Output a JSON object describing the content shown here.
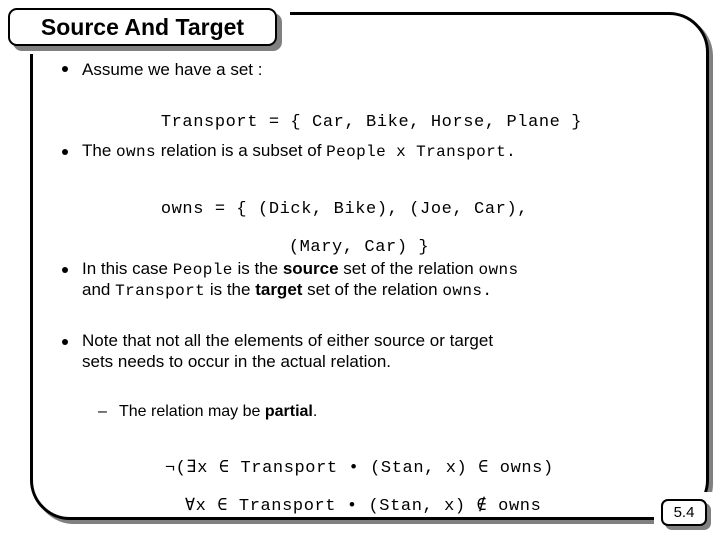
{
  "slide": {
    "title": "Source And Target",
    "page_number": "5.4",
    "accent_color": "#000000",
    "shadow_color": "#808080",
    "background_color": "#ffffff"
  },
  "bullets": [
    {
      "marker": "bullet-dot",
      "text_before": "Assume we have a set :",
      "code_lines": [
        "Transport = { Car, Bike, Horse, Plane }"
      ]
    },
    {
      "marker": "bullet-dot",
      "parts": [
        {
          "text": "The ",
          "style": "normal"
        },
        {
          "text": "owns",
          "style": "mono"
        },
        {
          "text": " relation is a subset of ",
          "style": "normal"
        },
        {
          "text": "People x Transport.",
          "style": "mono"
        }
      ],
      "code_lines": [
        "owns = { (Dick, Bike), (Joe, Car),",
        "(Mary, Car) }"
      ]
    },
    {
      "marker": "bullet-dot",
      "line1": [
        {
          "text": "In this case ",
          "style": "normal"
        },
        {
          "text": "People",
          "style": "mono"
        },
        {
          "text": " is the ",
          "style": "normal"
        },
        {
          "text": "source",
          "style": "bold"
        },
        {
          "text": " set of the relation ",
          "style": "normal"
        },
        {
          "text": "owns",
          "style": "mono"
        }
      ],
      "line2": [
        {
          "text": "and ",
          "style": "normal"
        },
        {
          "text": "Transport",
          "style": "mono"
        },
        {
          "text": " is the ",
          "style": "normal"
        },
        {
          "text": "target",
          "style": "bold"
        },
        {
          "text": " set of the relation ",
          "style": "normal"
        },
        {
          "text": "owns.",
          "style": "mono"
        }
      ]
    },
    {
      "marker": "bullet-dot",
      "line1": "Note that not all the elements of either source or target",
      "line2": "sets needs to occur in the actual relation."
    }
  ],
  "sub_bullet": {
    "marker": "–",
    "parts": [
      {
        "text": "The relation may be ",
        "style": "normal"
      },
      {
        "text": "partial",
        "style": "bold"
      },
      {
        "text": ".",
        "style": "normal"
      }
    ]
  },
  "formulas": [
    "¬(∃x ∈ Transport • (Stan, x) ∈ owns)",
    "∀x ∈ Transport • (Stan, x) ∉ owns"
  ]
}
